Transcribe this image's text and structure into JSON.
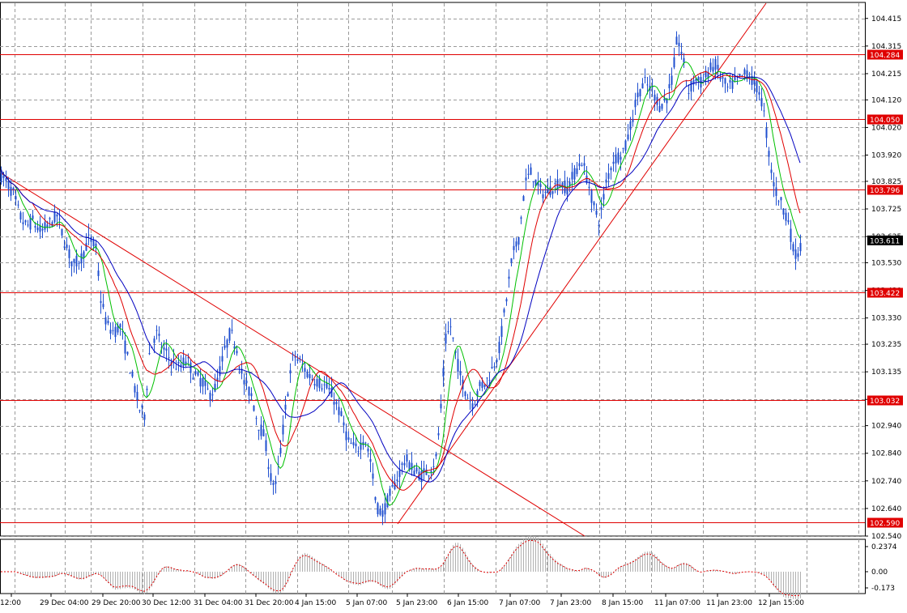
{
  "colors": {
    "background": "#ffffff",
    "grid": "#9a9a9a",
    "candle": "#1f4fcf",
    "ma_fast": "#00c000",
    "ma_mid": "#e00000",
    "ma_slow": "#0000c0",
    "level": "#e00000",
    "label_bg_level": "#e00000",
    "label_bg_price": "#000000",
    "osc": "#e00000"
  },
  "chart_data": {
    "type": "candlestick",
    "y_axis_ticks": [
      "104.415",
      "104.315",
      "104.215",
      "104.120",
      "104.020",
      "103.920",
      "103.825",
      "103.725",
      "103.625",
      "103.530",
      "103.430",
      "103.330",
      "103.235",
      "103.135",
      "103.035",
      "102.940",
      "102.840",
      "102.740",
      "102.640",
      "102.540"
    ],
    "ylim": [
      102.54,
      104.47
    ],
    "x_axis_ticks": [
      "12:00",
      "29 Dec 04:00",
      "29 Dec 20:00",
      "30 Dec 12:00",
      "31 Dec 04:00",
      "31 Dec 20:00",
      "4 Jan 15:00",
      "5 Jan 07:00",
      "5 Jan 23:00",
      "6 Jan 15:00",
      "7 Jan 07:00",
      "7 Jan 23:00",
      "8 Jan 15:00",
      "11 Jan 07:00",
      "11 Jan 23:00",
      "12 Jan 15:00"
    ],
    "horizontal_levels": [
      104.284,
      104.05,
      103.796,
      103.422,
      103.032,
      102.59
    ],
    "level_labels": [
      "104.284",
      "104.050",
      "103.796",
      "103.422",
      "103.032",
      "102.590"
    ],
    "current_price": 103.611,
    "current_price_label": "103.611",
    "price_path": [
      [
        0,
        103.85
      ],
      [
        8,
        103.82
      ],
      [
        16,
        103.78
      ],
      [
        24,
        103.7
      ],
      [
        32,
        103.66
      ],
      [
        40,
        103.68
      ],
      [
        50,
        103.64
      ],
      [
        60,
        103.67
      ],
      [
        70,
        103.7
      ],
      [
        80,
        103.6
      ],
      [
        90,
        103.52
      ],
      [
        100,
        103.55
      ],
      [
        110,
        103.62
      ],
      [
        118,
        103.58
      ],
      [
        124,
        103.4
      ],
      [
        132,
        103.3
      ],
      [
        140,
        103.28
      ],
      [
        148,
        103.3
      ],
      [
        156,
        103.2
      ],
      [
        164,
        103.1
      ],
      [
        172,
        103.0
      ],
      [
        178,
        102.98
      ],
      [
        184,
        103.2
      ],
      [
        192,
        103.28
      ],
      [
        200,
        103.22
      ],
      [
        210,
        103.18
      ],
      [
        220,
        103.15
      ],
      [
        230,
        103.18
      ],
      [
        240,
        103.12
      ],
      [
        250,
        103.1
      ],
      [
        258,
        103.05
      ],
      [
        266,
        103.08
      ],
      [
        276,
        103.2
      ],
      [
        284,
        103.28
      ],
      [
        292,
        103.22
      ],
      [
        300,
        103.1
      ],
      [
        310,
        103.05
      ],
      [
        318,
        102.95
      ],
      [
        326,
        102.9
      ],
      [
        334,
        102.75
      ],
      [
        340,
        102.72
      ],
      [
        346,
        102.85
      ],
      [
        354,
        103.05
      ],
      [
        362,
        103.2
      ],
      [
        372,
        103.16
      ],
      [
        382,
        103.12
      ],
      [
        392,
        103.1
      ],
      [
        402,
        103.08
      ],
      [
        410,
        103.05
      ],
      [
        420,
        102.98
      ],
      [
        430,
        102.88
      ],
      [
        440,
        102.85
      ],
      [
        450,
        102.9
      ],
      [
        458,
        102.8
      ],
      [
        464,
        102.65
      ],
      [
        472,
        102.62
      ],
      [
        480,
        102.68
      ],
      [
        490,
        102.75
      ],
      [
        500,
        102.82
      ],
      [
        510,
        102.78
      ],
      [
        520,
        102.76
      ],
      [
        530,
        102.78
      ],
      [
        538,
        102.82
      ],
      [
        544,
        103.0
      ],
      [
        550,
        103.25
      ],
      [
        556,
        103.3
      ],
      [
        562,
        103.2
      ],
      [
        568,
        103.12
      ],
      [
        576,
        103.05
      ],
      [
        584,
        103.02
      ],
      [
        592,
        103.08
      ],
      [
        600,
        103.1
      ],
      [
        608,
        103.15
      ],
      [
        616,
        103.22
      ],
      [
        624,
        103.38
      ],
      [
        632,
        103.55
      ],
      [
        640,
        103.62
      ],
      [
        648,
        103.82
      ],
      [
        656,
        103.86
      ],
      [
        664,
        103.8
      ],
      [
        672,
        103.78
      ],
      [
        680,
        103.8
      ],
      [
        690,
        103.82
      ],
      [
        700,
        103.8
      ],
      [
        710,
        103.86
      ],
      [
        718,
        103.9
      ],
      [
        726,
        103.82
      ],
      [
        734,
        103.72
      ],
      [
        740,
        103.68
      ],
      [
        748,
        103.82
      ],
      [
        756,
        103.9
      ],
      [
        764,
        103.92
      ],
      [
        772,
        103.95
      ],
      [
        780,
        104.05
      ],
      [
        788,
        104.15
      ],
      [
        796,
        104.18
      ],
      [
        806,
        104.15
      ],
      [
        814,
        104.1
      ],
      [
        822,
        104.12
      ],
      [
        830,
        104.2
      ],
      [
        836,
        104.35
      ],
      [
        842,
        104.28
      ],
      [
        850,
        104.15
      ],
      [
        858,
        104.2
      ],
      [
        866,
        104.18
      ],
      [
        874,
        104.22
      ],
      [
        882,
        104.25
      ],
      [
        890,
        104.2
      ],
      [
        898,
        104.16
      ],
      [
        906,
        104.18
      ],
      [
        914,
        104.2
      ],
      [
        922,
        104.22
      ],
      [
        930,
        104.18
      ],
      [
        938,
        104.15
      ],
      [
        944,
        104.05
      ],
      [
        950,
        103.9
      ],
      [
        956,
        103.8
      ],
      [
        962,
        103.76
      ],
      [
        968,
        103.72
      ],
      [
        974,
        103.68
      ],
      [
        978,
        103.58
      ],
      [
        984,
        103.56
      ],
      [
        990,
        103.6
      ]
    ],
    "oscillator_ticks": [
      "0.2374",
      "0.00",
      "-0.173"
    ]
  }
}
